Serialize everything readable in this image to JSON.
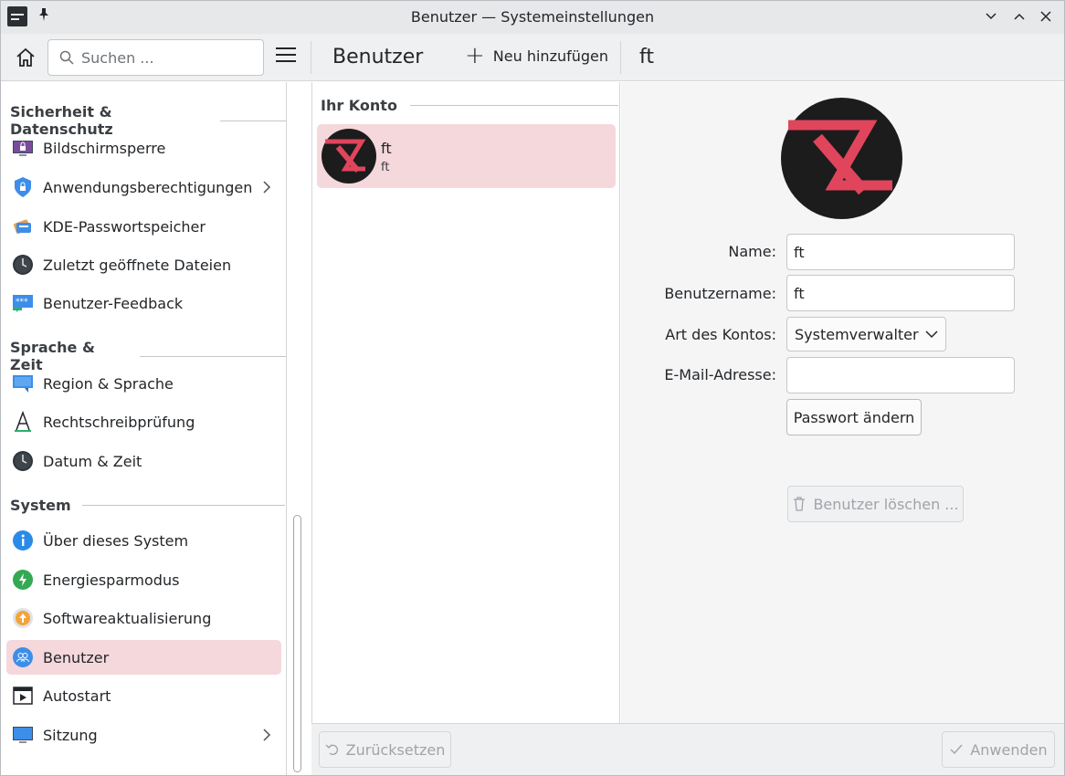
{
  "window": {
    "title": "Benutzer — Systemeinstellungen"
  },
  "toolbar": {
    "search_placeholder": "Suchen ...",
    "page_heading": "Benutzer",
    "add_label": "Neu hinzufügen",
    "sub_heading": "ft"
  },
  "sidebar": {
    "sections": [
      {
        "title": "Sicherheit & Datenschutz"
      },
      {
        "title": "Sprache & Zeit"
      },
      {
        "title": "System"
      }
    ],
    "items": [
      {
        "label": "Bildschirmsperre",
        "icon": "lock-screen-icon"
      },
      {
        "label": "Anwendungsberechtigungen",
        "icon": "shield-lock-icon"
      },
      {
        "label": "KDE-Passwortspeicher",
        "icon": "wallet-icon"
      },
      {
        "label": "Zuletzt geöffnete Dateien",
        "icon": "clock-icon"
      },
      {
        "label": "Benutzer-Feedback",
        "icon": "feedback-icon"
      },
      {
        "label": "Region & Sprache",
        "icon": "region-flag-icon"
      },
      {
        "label": "Rechtschreibprüfung",
        "icon": "spellcheck-icon"
      },
      {
        "label": "Datum & Zeit",
        "icon": "clock-icon"
      },
      {
        "label": "Über dieses System",
        "icon": "info-icon"
      },
      {
        "label": "Energiesparmodus",
        "icon": "power-icon"
      },
      {
        "label": "Softwareaktualisierung",
        "icon": "update-icon"
      },
      {
        "label": "Benutzer",
        "icon": "users-icon"
      },
      {
        "label": "Autostart",
        "icon": "autostart-icon"
      },
      {
        "label": "Sitzung",
        "icon": "session-icon"
      }
    ]
  },
  "accounts": {
    "section_title": "Ihr Konto",
    "user": {
      "name": "ft",
      "login": "ft"
    }
  },
  "details": {
    "name_label": "Name:",
    "name_value": "ft",
    "username_label": "Benutzername:",
    "username_value": "ft",
    "account_type_label": "Art des Kontos:",
    "account_type_value": "Systemverwalter",
    "email_label": "E-Mail-Adresse:",
    "email_value": "",
    "change_password_label": "Passwort ändern",
    "delete_user_label": "Benutzer löschen ..."
  },
  "footer": {
    "reset_label": "Zurücksetzen",
    "apply_label": "Anwenden"
  },
  "colors": {
    "accent_selection": "#f5d8dc",
    "avatar_red": "#e0455c",
    "avatar_bg": "#1c1c1c"
  }
}
